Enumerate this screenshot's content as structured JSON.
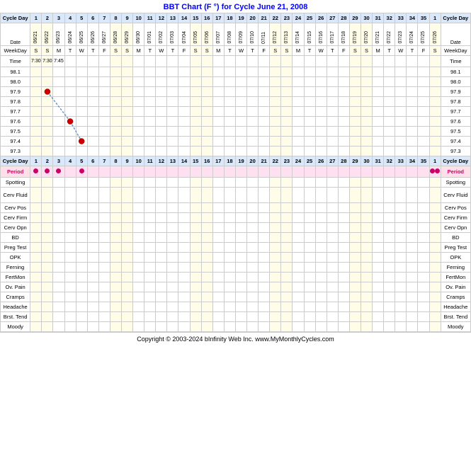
{
  "title": {
    "text": "BBT Chart (F °) for Cycle",
    "highlight": "June 21, 2008"
  },
  "cycle_days": [
    "1",
    "2",
    "3",
    "4",
    "5",
    "6",
    "7",
    "8",
    "9",
    "10",
    "11",
    "12",
    "13",
    "14",
    "15",
    "16",
    "17",
    "18",
    "19",
    "20",
    "21",
    "22",
    "23",
    "24",
    "25",
    "26",
    "27",
    "28",
    "29",
    "30",
    "31",
    "32",
    "33",
    "34",
    "35",
    "1"
  ],
  "dates": [
    "06/21",
    "06/22",
    "06/23",
    "06/24",
    "06/25",
    "06/26",
    "06/27",
    "06/28",
    "06/29",
    "06/30",
    "07/01",
    "07/02",
    "07/03",
    "07/04",
    "07/05",
    "07/06",
    "07/07",
    "07/08",
    "07/09",
    "07/10",
    "07/11",
    "07/12",
    "07/13",
    "07/14",
    "07/15",
    "07/16",
    "07/17",
    "07/18",
    "07/19",
    "07/20",
    "07/21",
    "07/22",
    "07/23",
    "07/24",
    "07/25",
    "07/26"
  ],
  "weekdays": [
    "S",
    "S",
    "M",
    "T",
    "W",
    "T",
    "F",
    "S",
    "S",
    "M",
    "T",
    "W",
    "T",
    "F",
    "S",
    "S",
    "M",
    "T",
    "W",
    "T",
    "F",
    "S",
    "S",
    "M",
    "T",
    "W",
    "T",
    "F",
    "S",
    "S",
    "M",
    "T",
    "W",
    "T",
    "F",
    "S"
  ],
  "times": [
    "7:30",
    "7:30",
    "7:45",
    "",
    "",
    "",
    "",
    "",
    "",
    "",
    "",
    "",
    "",
    "",
    "",
    "",
    "",
    "",
    "",
    "",
    "",
    "",
    "",
    "",
    "",
    "",
    "",
    "",
    "",
    "",
    "",
    "",
    "",
    "",
    "",
    ""
  ],
  "temps": {
    "98.1": [
      null,
      null,
      null,
      null,
      null,
      null,
      null,
      null,
      null,
      null,
      null,
      null,
      null,
      null,
      null,
      null,
      null,
      null,
      null,
      null,
      null,
      null,
      null,
      null,
      null,
      null,
      null,
      null,
      null,
      null,
      null,
      null,
      null,
      null,
      null,
      null
    ],
    "98.0": [
      null,
      null,
      null,
      null,
      null,
      null,
      null,
      null,
      null,
      null,
      null,
      null,
      null,
      null,
      null,
      null,
      null,
      null,
      null,
      null,
      null,
      null,
      null,
      null,
      null,
      null,
      null,
      null,
      null,
      null,
      null,
      null,
      null,
      null,
      null,
      null
    ],
    "97.9": [
      null,
      null,
      null,
      null,
      null,
      null,
      null,
      null,
      null,
      null,
      null,
      null,
      null,
      null,
      null,
      null,
      null,
      null,
      null,
      null,
      null,
      null,
      null,
      null,
      null,
      null,
      null,
      null,
      null,
      null,
      null,
      null,
      null,
      null,
      null,
      null
    ],
    "97.8": [
      null,
      null,
      null,
      null,
      null,
      null,
      null,
      null,
      null,
      null,
      null,
      null,
      null,
      null,
      null,
      null,
      null,
      null,
      null,
      null,
      null,
      null,
      null,
      null,
      null,
      null,
      null,
      null,
      null,
      null,
      null,
      null,
      null,
      null,
      null,
      null
    ],
    "97.7": [
      null,
      null,
      null,
      null,
      null,
      null,
      null,
      null,
      null,
      null,
      null,
      null,
      null,
      null,
      null,
      null,
      null,
      null,
      null,
      null,
      null,
      null,
      null,
      null,
      null,
      null,
      null,
      null,
      null,
      null,
      null,
      null,
      null,
      null,
      null,
      null
    ],
    "97.6": [
      null,
      null,
      null,
      null,
      null,
      null,
      null,
      null,
      null,
      null,
      null,
      null,
      null,
      null,
      null,
      null,
      null,
      null,
      null,
      null,
      null,
      null,
      null,
      null,
      null,
      null,
      null,
      null,
      null,
      null,
      null,
      null,
      null,
      null,
      null,
      null
    ],
    "97.5": [
      null,
      null,
      null,
      null,
      null,
      null,
      null,
      null,
      null,
      null,
      null,
      null,
      null,
      null,
      null,
      null,
      null,
      null,
      null,
      null,
      null,
      null,
      null,
      null,
      null,
      null,
      null,
      null,
      null,
      null,
      null,
      null,
      null,
      null,
      null,
      null
    ],
    "97.4": [
      null,
      null,
      null,
      null,
      null,
      null,
      null,
      null,
      null,
      null,
      null,
      null,
      null,
      null,
      null,
      null,
      null,
      null,
      null,
      null,
      null,
      null,
      null,
      null,
      null,
      null,
      null,
      null,
      null,
      null,
      null,
      null,
      null,
      null,
      null,
      null
    ],
    "97.3": [
      null,
      null,
      null,
      null,
      null,
      null,
      null,
      null,
      null,
      null,
      null,
      null,
      null,
      null,
      null,
      null,
      null,
      null,
      null,
      null,
      null,
      null,
      null,
      null,
      null,
      null,
      null,
      null,
      null,
      null,
      null,
      null,
      null,
      null,
      null,
      null
    ]
  },
  "temp_labels": [
    "98.1",
    "98.0",
    "97.9",
    "97.8",
    "97.7",
    "97.6",
    "97.5",
    "97.4",
    "97.3"
  ],
  "data_points": [
    {
      "col": 2,
      "temp": "97.9"
    },
    {
      "col": 4,
      "temp": "97.6"
    },
    {
      "col": 5,
      "temp": "97.4"
    }
  ],
  "period_dots": [
    1,
    2,
    3,
    5
  ],
  "period_dot_last": 35,
  "row_labels": {
    "cycle_day": "Cycle Day",
    "date": "Date",
    "weekday": "WeekDay",
    "time": "Time",
    "period": "Period",
    "spotting": "Spotting",
    "cerv_fluid": "Cerv Fluid",
    "cerv_pos": "Cerv Pos",
    "cerv_firm": "Cerv Firm",
    "cerv_opn": "Cerv Opn",
    "bd": "BD",
    "preg_test": "Preg Test",
    "opk": "OPK",
    "ferning": "Ferning",
    "fertmon": "FertMon",
    "ov_pain": "Ov. Pain",
    "cramps": "Cramps",
    "headache": "Headache",
    "brst_tend": "Brst. Tend",
    "moody": "Moody"
  },
  "footer": "Copyright © 2003-2024 bInfinity Web Inc.   www.MyMonthlyCycles.com"
}
